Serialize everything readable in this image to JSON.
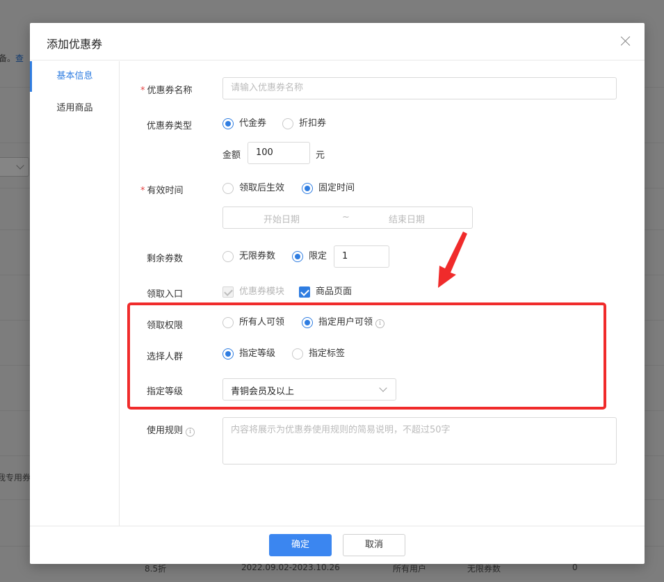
{
  "background": {
    "link_prefix": "备。",
    "link_text": "查",
    "row_text": "我专用券",
    "bottom_row": {
      "discount": "8.5折",
      "period": "2022.09.02-2023.10.26",
      "audience": "所有用户",
      "stock": "无限券数",
      "count": "0"
    }
  },
  "dialog": {
    "title": "添加优惠券",
    "tabs": [
      {
        "label": "基本信息",
        "active": true
      },
      {
        "label": "适用商品",
        "active": false
      }
    ],
    "form": {
      "coupon_name": {
        "label": "优惠券名称",
        "required": true,
        "placeholder": "请输入优惠券名称"
      },
      "coupon_type": {
        "label": "优惠券类型",
        "options": [
          "代金券",
          "折扣券"
        ],
        "selected": "代金券"
      },
      "amount": {
        "label": "金额",
        "value": "100",
        "unit": "元"
      },
      "valid_time": {
        "label": "有效时间",
        "required": true,
        "options": [
          "领取后生效",
          "固定时间"
        ],
        "selected": "固定时间"
      },
      "date_range": {
        "start_placeholder": "开始日期",
        "separator": "~",
        "end_placeholder": "结束日期"
      },
      "remaining": {
        "label": "剩余券数",
        "options": [
          "无限券数",
          "限定"
        ],
        "selected": "限定",
        "value": "1"
      },
      "entry": {
        "label": "领取入口",
        "options": [
          {
            "label": "优惠券模块",
            "checked": true,
            "disabled": true
          },
          {
            "label": "商品页面",
            "checked": true,
            "disabled": false
          }
        ]
      },
      "permission": {
        "label": "领取权限",
        "options": [
          "所有人可领",
          "指定用户可领"
        ],
        "selected": "指定用户可领",
        "info_icon": "ⓘ"
      },
      "crowd": {
        "label": "选择人群",
        "options": [
          "指定等级",
          "指定标签"
        ],
        "selected": "指定等级"
      },
      "level": {
        "label": "指定等级",
        "value": "青铜会员及以上"
      },
      "rules": {
        "label": "使用规则",
        "info_icon": "ⓘ",
        "placeholder": "内容将展示为优惠券使用规则的简易说明，不超过50字"
      }
    },
    "buttons": {
      "confirm": "确定",
      "cancel": "取消"
    }
  },
  "annotation": {
    "highlight_color": "#f02b2b"
  }
}
